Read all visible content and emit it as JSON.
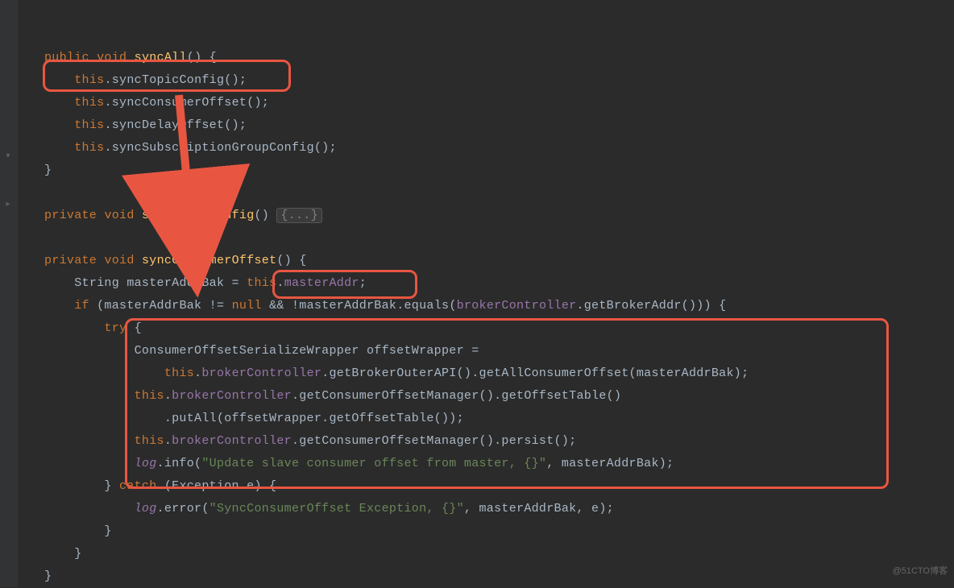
{
  "watermark": "@51CTO博客",
  "code": {
    "l1": {
      "kw1": "public",
      "kw2": "void",
      "name": "syncAll",
      "p": "() {"
    },
    "l2": {
      "kw": "this",
      "p1": ".",
      "fn": "syncTopicConfig",
      "p2": "();"
    },
    "l3": {
      "kw": "this",
      "p1": ".",
      "fn": "syncConsumerOffset",
      "p2": "();"
    },
    "l4": {
      "kw": "this",
      "p1": ".",
      "fn": "syncDelayOffset",
      "p2": "();"
    },
    "l5": {
      "kw": "this",
      "p1": ".",
      "fn": "syncSubscriptionGroupConfig",
      "p2": "();"
    },
    "l6": {
      "p": "}"
    },
    "l8": {
      "kw1": "private",
      "kw2": "void",
      "name": "syncTopicConfig",
      "p": "() ",
      "fold": "{...}"
    },
    "l10": {
      "kw1": "private",
      "kw2": "void",
      "name": "syncConsumerOffset",
      "p": "() {"
    },
    "l11": {
      "t1": "String masterAddrBak = ",
      "kw": "this",
      "p1": ".",
      "fld": "masterAddr",
      "p2": ";"
    },
    "l12": {
      "kw1": "if",
      "t1": " (masterAddrBak != ",
      "kw2": "null",
      "t2": " && !masterAddrBak.equals(",
      "fld": "brokerController",
      "t3": ".getBrokerAddr())) {"
    },
    "l13": {
      "kw": "try",
      "p": " {"
    },
    "l14": {
      "t": "ConsumerOffsetSerializeWrapper offsetWrapper ="
    },
    "l15": {
      "kw": "this",
      "p1": ".",
      "fld": "brokerController",
      "t": ".getBrokerOuterAPI().getAllConsumerOffset(masterAddrBak);"
    },
    "l16": {
      "kw": "this",
      "p1": ".",
      "fld": "brokerController",
      "t": ".getConsumerOffsetManager().getOffsetTable()"
    },
    "l17": {
      "t": ".putAll(offsetWrapper.getOffsetTable());"
    },
    "l18": {
      "kw": "this",
      "p1": ".",
      "fld": "brokerController",
      "t": ".getConsumerOffsetManager().persist();"
    },
    "l19": {
      "log": "log",
      "t1": ".info(",
      "str": "\"Update slave consumer offset from master, {}\"",
      "t2": ", masterAddrBak);"
    },
    "l20": {
      "p1": "} ",
      "kw": "catch",
      "t": " (Exception e) {"
    },
    "l21": {
      "log": "log",
      "t1": ".error(",
      "str": "\"SyncConsumerOffset Exception, {}\"",
      "t2": ", masterAddrBak, e);"
    },
    "l22": {
      "p": "}"
    },
    "l23": {
      "p": "}"
    },
    "l24": {
      "p": "}"
    }
  }
}
